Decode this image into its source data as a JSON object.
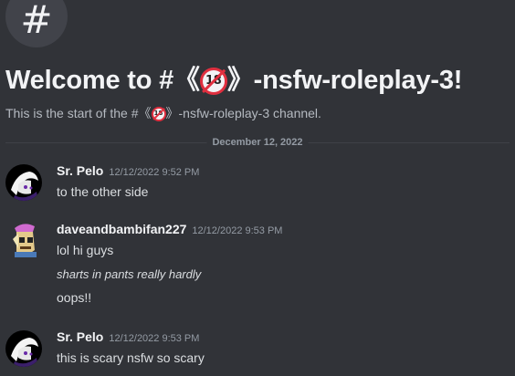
{
  "channel": {
    "hash_symbol": "#",
    "welcome_prefix": "Welcome to #《",
    "welcome_suffix": "》-nsfw-roleplay-3!",
    "start_prefix": "This is the start of the #《",
    "start_suffix": "》-nsfw-roleplay-3 channel.",
    "emoji_text": "18",
    "emoji_icon": "no-under-18-icon"
  },
  "divider": {
    "date": "December 12, 2022"
  },
  "colors": {
    "background": "#313338",
    "text": "#dbdee1",
    "muted": "#949ba4",
    "emoji_red": "#e02f3f"
  },
  "messages": [
    {
      "author": "Sr. Pelo",
      "timestamp": "12/12/2022 9:52 PM",
      "lines": [
        "to the other side"
      ]
    },
    {
      "author": "daveandbambifan227",
      "timestamp": "12/12/2022 9:53 PM",
      "lines": [
        "lol hi guys",
        "sharts in pants really hardly",
        "oops!!"
      ]
    },
    {
      "author": "Sr. Pelo",
      "timestamp": "12/12/2022 9:53 PM",
      "lines": [
        "this is scary nsfw so scary"
      ]
    }
  ]
}
